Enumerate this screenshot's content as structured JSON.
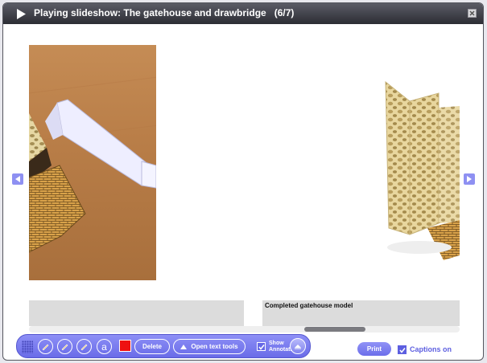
{
  "window": {
    "title": "Playing slideshow: The gatehouse and drawbridge",
    "counter": "(6/7)"
  },
  "icons": {
    "play": "play-icon",
    "close": "close-icon",
    "prev": "chevron-left-icon",
    "next": "chevron-right-icon",
    "pen1": "pencil-icon",
    "pen2": "pencil-icon",
    "pen3": "pencil-icon",
    "text": "text-icon",
    "collapse": "chevron-up-icon"
  },
  "slides": [
    {
      "caption": ""
    },
    {
      "caption": "Completed gatehouse model"
    }
  ],
  "toolbar": {
    "text_tool_glyph": "a",
    "pen_color": "#ee1111",
    "delete_label": "Delete",
    "open_text_tools_label": "Open text tools",
    "show_annotations_line1": "Show",
    "show_annotations_line2": "Annotations",
    "show_annotations_checked": true
  },
  "footer": {
    "print_label": "Print",
    "captions_label": "Captions on",
    "captions_checked": true
  },
  "colors": {
    "accent": "#6a6ce8",
    "titlebar": "#2c2d34"
  }
}
